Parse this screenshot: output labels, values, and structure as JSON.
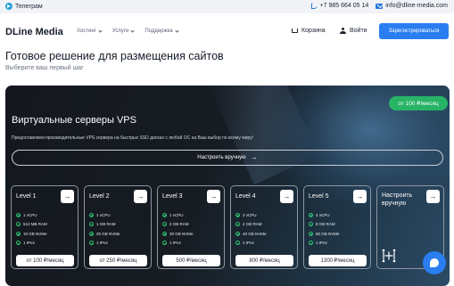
{
  "topbar": {
    "telegram": "Телеграм",
    "phone": "+7 985 664 05 14",
    "email": "info@dline-media.com"
  },
  "header": {
    "logo": "DLine Media",
    "nav": [
      "Хостинг",
      "Услуги",
      "Поддержка"
    ],
    "cart": "Корзина",
    "login": "Войти",
    "register": "Зарегистрироваться"
  },
  "page": {
    "title": "Готовое решение для размещения сайтов",
    "subtitle": "Выберите ваш первый шаг"
  },
  "vps": {
    "badge": "от 100 ₽/месяц",
    "title": "Виртуальные серверы VPS",
    "description": "Предоставляем производительные VPS сервера на быстрых SSD дисках с любой ОС на Ваш выбор по всему миру!",
    "configure": "Настроить вручную",
    "levels": [
      {
        "name": "Level 1",
        "specs": [
          "1 vCPU",
          "512 MB RAM",
          "10 GB NVMe",
          "1 IPv4"
        ],
        "price": "от 100 ₽/месяц"
      },
      {
        "name": "Level 2",
        "specs": [
          "1 vCPU",
          "1 GB RAM",
          "20 GB NVMe",
          "1 IPv4"
        ],
        "price": "от 250 ₽/месяц"
      },
      {
        "name": "Level 3",
        "specs": [
          "1 vCPU",
          "2 GB RAM",
          "30 GB NVMe",
          "1 IPv4"
        ],
        "price": "500 ₽/месяц"
      },
      {
        "name": "Level 4",
        "specs": [
          "2 vCPU",
          "4 GB RAM",
          "40 GB NVMe",
          "1 IPv4"
        ],
        "price": "800 ₽/месяц"
      },
      {
        "name": "Level 5",
        "specs": [
          "4 vCPU",
          "8 GB RAM",
          "60 GB NVMe",
          "1 IPv4"
        ],
        "price": "1300 ₽/месяц"
      }
    ],
    "custom": "Настроить вручную"
  },
  "colors": {
    "accent": "#2a7ef0",
    "badge": "#27b466",
    "card_bg": "#171c23"
  },
  "icons": [
    "telegram-icon",
    "phone-icon",
    "mail-icon",
    "cart-icon",
    "user-icon",
    "arrow-right-icon",
    "check-icon",
    "configurator-icon",
    "chat-icon"
  ]
}
